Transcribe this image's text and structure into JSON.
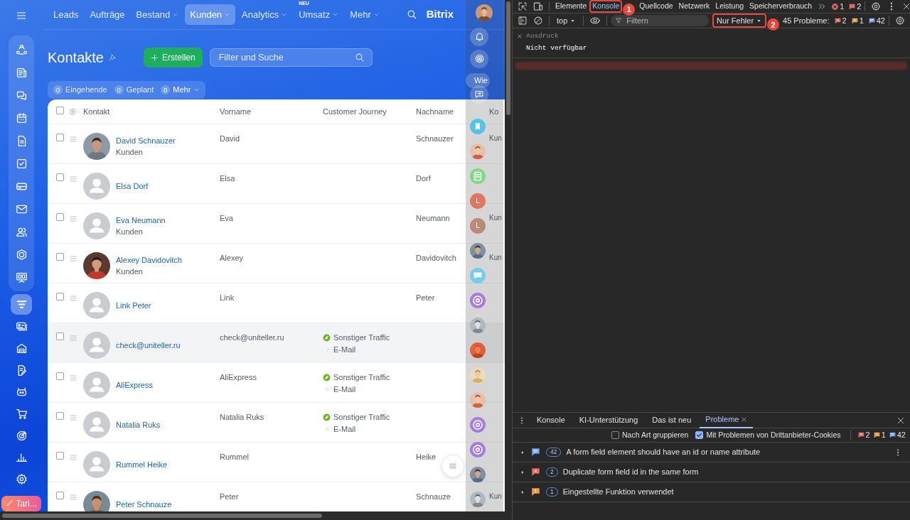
{
  "app": {
    "nav": [
      {
        "label": "Leads",
        "selected": false,
        "dropdown": false
      },
      {
        "label": "Aufträge",
        "selected": false,
        "dropdown": false
      },
      {
        "label": "Bestand",
        "selected": false,
        "dropdown": true
      },
      {
        "label": "Kunden",
        "selected": true,
        "dropdown": true
      },
      {
        "label": "Analytics",
        "selected": false,
        "dropdown": true
      },
      {
        "label": "Umsatz",
        "badge": "NEU",
        "selected": false,
        "dropdown": true
      },
      {
        "label": "Mehr",
        "selected": false,
        "dropdown": true
      }
    ],
    "brand": "Bitrix",
    "sidebar": {
      "pinned": [
        {
          "kind": "nodes",
          "selected": false
        },
        {
          "kind": "news",
          "selected": false
        },
        {
          "kind": "chat",
          "selected": false
        },
        {
          "kind": "calendar",
          "selected": false
        },
        {
          "kind": "document",
          "selected": false
        },
        {
          "kind": "task",
          "selected": false
        },
        {
          "kind": "card",
          "selected": false
        },
        {
          "kind": "mail",
          "selected": false
        },
        {
          "kind": "contacts",
          "selected": false
        },
        {
          "kind": "hexagon",
          "selected": false
        },
        {
          "kind": "board",
          "selected": false
        }
      ],
      "items": [
        {
          "kind": "filter",
          "selected": true
        },
        {
          "kind": "idcards",
          "selected": false
        },
        {
          "kind": "warehouse",
          "selected": false
        },
        {
          "kind": "sign",
          "selected": false
        },
        {
          "kind": "robot",
          "selected": false
        },
        {
          "kind": "cart",
          "selected": false
        },
        {
          "kind": "target",
          "selected": false
        },
        {
          "kind": "chart",
          "selected": false
        },
        {
          "kind": "gear",
          "selected": false
        }
      ],
      "upgrade_button": "Tari..."
    },
    "page_title": "Kontakte",
    "create_button": "Erstellen",
    "search": {
      "placeholder": "Filter und Suche"
    },
    "counters": [
      {
        "count": "0",
        "label": "Eingehende",
        "dropdown": false
      },
      {
        "count": "0",
        "label": "Geplant",
        "dropdown": false
      },
      {
        "count": "0",
        "label": "Mehr",
        "dropdown": true
      }
    ],
    "table": {
      "all_checked": false,
      "columns": [
        "Kontakt",
        "Vorname",
        "Customer Journey",
        "Nachname",
        "Ko"
      ],
      "rows": [
        {
          "name": "David Schnauzer",
          "subtitle": "Kunden",
          "vorname": "David",
          "nachname": "Schnauzer",
          "column_5": "Kun",
          "checked": false,
          "highlighted": false
        },
        {
          "name": "Elsa Dorf",
          "kind": "placeholder",
          "vorname": "Elsa",
          "nachname": "Dorf",
          "checked": false,
          "highlighted": false
        },
        {
          "name": "Eva Neumann",
          "subtitle": "Kunden",
          "kind": "placeholder",
          "vorname": "Eva",
          "nachname": "Neumann",
          "column_5": "Kun",
          "checked": false,
          "highlighted": false
        },
        {
          "name": "Alexey Davidovitch",
          "subtitle": "Kunden",
          "vorname": "Alexey",
          "nachname": "Davidovitch",
          "column_5": "Kun",
          "checked": false,
          "highlighted": false
        },
        {
          "name": "Link Peter",
          "kind": "placeholder",
          "vorname": "Link",
          "nachname": "Peter",
          "checked": false,
          "highlighted": false
        },
        {
          "name": "check@uniteller.ru",
          "kind": "placeholder",
          "vorname": "check@uniteller.ru",
          "journey": {
            "source": "Sonstiger Traffic",
            "channel": "E-Mail"
          },
          "checked": false,
          "highlighted": true
        },
        {
          "name": "AliExpress",
          "kind": "placeholder",
          "vorname": "AliExpress",
          "journey": {
            "source": "Sonstiger Traffic",
            "channel": "E-Mail"
          },
          "checked": false,
          "highlighted": false
        },
        {
          "name": "Natalia Ruks",
          "kind": "placeholder",
          "vorname": "Natalia Ruks",
          "journey": {
            "source": "Sonstiger Traffic",
            "channel": "E-Mail"
          },
          "checked": false,
          "highlighted": false
        },
        {
          "name": "Rummel Heike",
          "kind": "placeholder",
          "vorname": "Rummel",
          "nachname": "Heike",
          "checked": false,
          "highlighted": false
        },
        {
          "name": "Peter Schnauze",
          "vorname": "Peter",
          "nachname": "Schnauze",
          "column_5": "Kun",
          "checked": false,
          "highlighted": false
        }
      ]
    },
    "side_panel": {
      "chip": "Wie",
      "items": [
        {
          "kind": "bookmark"
        },
        {
          "kind": "picture"
        },
        {
          "kind": "notes"
        },
        {
          "kind": "letter",
          "text": "L",
          "color": "#e07560"
        },
        {
          "kind": "letter",
          "text": "L",
          "color": "#b98a78"
        },
        {
          "kind": "picture"
        },
        {
          "kind": "chat"
        },
        {
          "kind": "copilot"
        },
        {
          "kind": "picture"
        },
        {
          "kind": "picture"
        },
        {
          "kind": "picture"
        },
        {
          "kind": "picture"
        },
        {
          "kind": "copilot"
        },
        {
          "kind": "copilot"
        },
        {
          "kind": "picture"
        },
        {
          "kind": "picture"
        }
      ]
    }
  },
  "devtools": {
    "tabs": [
      {
        "label": "Elemente",
        "selected": false
      },
      {
        "label": "Konsole",
        "selected": true
      },
      {
        "label": "Quellcode",
        "selected": false
      },
      {
        "label": "Netzwerk",
        "selected": false
      },
      {
        "label": "Leistung",
        "selected": false
      },
      {
        "label": "Speicherverbrauch",
        "selected": false
      }
    ],
    "error_count": "1",
    "issue_count": "2",
    "context": "top",
    "filter": {
      "placeholder": "Filtern"
    },
    "level_filter": "Nur Fehler",
    "problems_label": "45 Probleme:",
    "problem_counts": [
      {
        "kind": "error",
        "count": "2"
      },
      {
        "kind": "warning",
        "count": "1"
      },
      {
        "kind": "info",
        "count": "42"
      }
    ],
    "console": {
      "expression_label": "Ausdruck",
      "expression_value": "Nicht verfügbar",
      "redacted_error_line": true
    },
    "drawer": {
      "tabs": [
        {
          "label": "Konsole",
          "selected": false,
          "closable": false
        },
        {
          "label": "KI-Unterstützung",
          "selected": false,
          "closable": false
        },
        {
          "label": "Das ist neu",
          "selected": false,
          "closable": false
        },
        {
          "label": "Probleme",
          "selected": true,
          "closable": true
        }
      ],
      "options": [
        {
          "label": "Nach Art gruppieren",
          "checked": false
        },
        {
          "label": "Mit Problemen von Drittanbieter-Cookies",
          "checked": true
        }
      ],
      "counts": [
        {
          "kind": "error",
          "count": "2"
        },
        {
          "kind": "warning",
          "count": "1"
        },
        {
          "kind": "info",
          "count": "42"
        }
      ],
      "issues": [
        {
          "kind": "info",
          "count": "42",
          "text": "A form field element should have an id or name attribute",
          "menu": true
        },
        {
          "kind": "error",
          "count": "2",
          "text": "Duplicate form field id in the same form",
          "menu": false
        },
        {
          "kind": "warning",
          "count": "1",
          "text": "Eingestellte Funktion verwendet",
          "menu": false
        }
      ]
    }
  },
  "annotations": [
    {
      "label": "1",
      "kind": "tab"
    },
    {
      "label": "2",
      "kind": "filter"
    }
  ]
}
